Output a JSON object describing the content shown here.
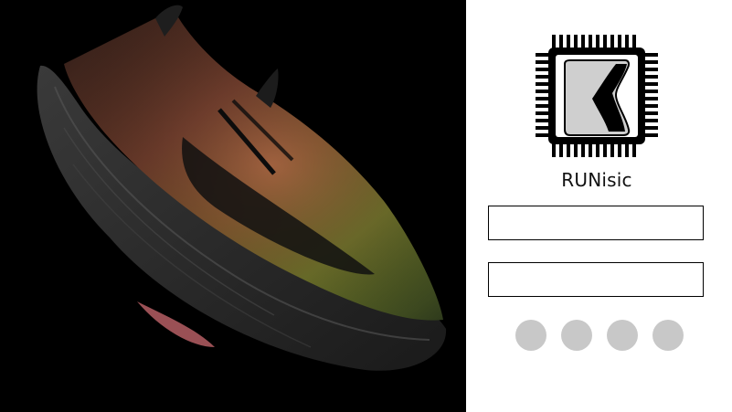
{
  "hero": {
    "image": "running-shoe-photo",
    "background": "#000000"
  },
  "logo": {
    "icon": "chip-shoe-logo-icon",
    "brand_name": "RUNisic"
  },
  "form": {
    "field_1": {
      "value": "",
      "placeholder": ""
    },
    "field_2": {
      "value": "",
      "placeholder": ""
    }
  },
  "pager": {
    "dot_count": 4,
    "dot_color": "#c8c8c8"
  }
}
